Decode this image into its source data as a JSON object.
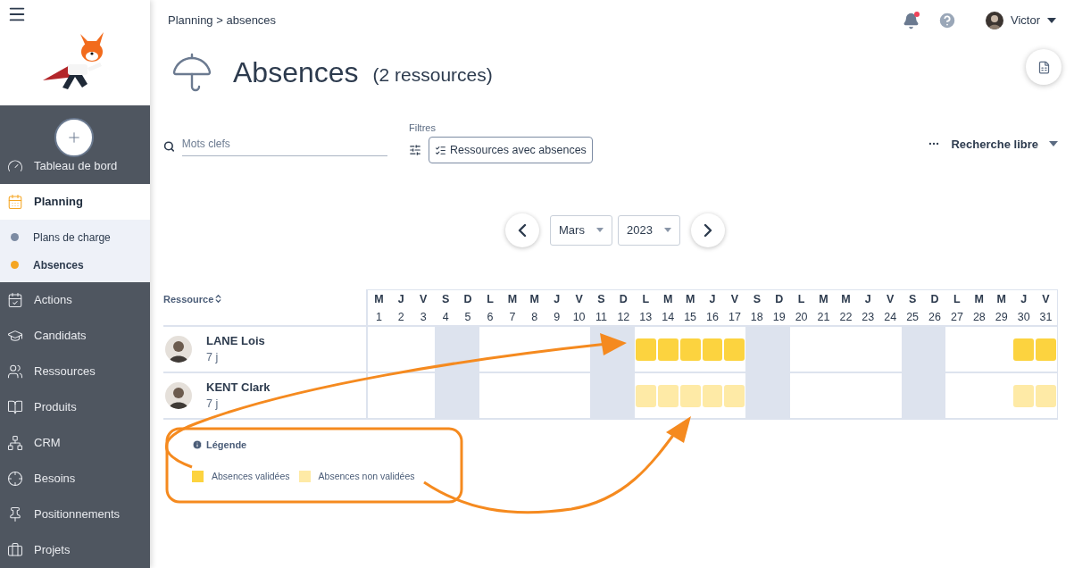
{
  "sidebar": {
    "items": [
      {
        "label": "Tableau de bord",
        "selected": false
      },
      {
        "label": "Planning",
        "selected": true,
        "children": [
          {
            "label": "Plans de charge",
            "selected": false
          },
          {
            "label": "Absences",
            "selected": true
          }
        ]
      },
      {
        "label": "Actions",
        "selected": false
      },
      {
        "label": "Candidats",
        "selected": false
      },
      {
        "label": "Ressources",
        "selected": false
      },
      {
        "label": "Produits",
        "selected": false
      },
      {
        "label": "CRM",
        "selected": false
      },
      {
        "label": "Besoins",
        "selected": false
      },
      {
        "label": "Positionnements",
        "selected": false
      },
      {
        "label": "Projets",
        "selected": false
      }
    ]
  },
  "breadcrumb": {
    "parent": "Planning",
    "separator": ">",
    "current": "absences"
  },
  "user": {
    "name": "Victor",
    "has_notification": true
  },
  "page": {
    "title": "Absences",
    "count": "(2 ressources)"
  },
  "search": {
    "placeholder": "Mots clefs"
  },
  "filters": {
    "label": "Filtres",
    "chip": "Ressources avec absences",
    "free_search": "Recherche libre"
  },
  "period": {
    "month": "Mars",
    "year": "2023"
  },
  "table": {
    "resource_header": "Ressource",
    "days": [
      {
        "letter": "M",
        "number": "1",
        "kind": "weekday"
      },
      {
        "letter": "J",
        "number": "2",
        "kind": "weekday"
      },
      {
        "letter": "V",
        "number": "3",
        "kind": "weekday"
      },
      {
        "letter": "S",
        "number": "4",
        "kind": "weekend"
      },
      {
        "letter": "D",
        "number": "5",
        "kind": "weekend"
      },
      {
        "letter": "L",
        "number": "6",
        "kind": "weekday"
      },
      {
        "letter": "M",
        "number": "7",
        "kind": "weekday"
      },
      {
        "letter": "M",
        "number": "8",
        "kind": "weekday"
      },
      {
        "letter": "J",
        "number": "9",
        "kind": "weekday"
      },
      {
        "letter": "V",
        "number": "10",
        "kind": "weekday"
      },
      {
        "letter": "S",
        "number": "11",
        "kind": "weekend"
      },
      {
        "letter": "D",
        "number": "12",
        "kind": "weekend"
      },
      {
        "letter": "L",
        "number": "13",
        "kind": "weekday"
      },
      {
        "letter": "M",
        "number": "14",
        "kind": "weekday"
      },
      {
        "letter": "M",
        "number": "15",
        "kind": "weekday"
      },
      {
        "letter": "J",
        "number": "16",
        "kind": "weekday"
      },
      {
        "letter": "V",
        "number": "17",
        "kind": "weekday"
      },
      {
        "letter": "S",
        "number": "18",
        "kind": "weekend"
      },
      {
        "letter": "D",
        "number": "19",
        "kind": "weekend"
      },
      {
        "letter": "L",
        "number": "20",
        "kind": "weekday"
      },
      {
        "letter": "M",
        "number": "21",
        "kind": "weekday"
      },
      {
        "letter": "M",
        "number": "22",
        "kind": "weekday"
      },
      {
        "letter": "J",
        "number": "23",
        "kind": "weekday"
      },
      {
        "letter": "V",
        "number": "24",
        "kind": "weekday"
      },
      {
        "letter": "S",
        "number": "25",
        "kind": "weekend"
      },
      {
        "letter": "D",
        "number": "26",
        "kind": "weekend"
      },
      {
        "letter": "L",
        "number": "27",
        "kind": "weekday"
      },
      {
        "letter": "M",
        "number": "28",
        "kind": "weekday"
      },
      {
        "letter": "M",
        "number": "29",
        "kind": "weekday"
      },
      {
        "letter": "J",
        "number": "30",
        "kind": "weekday"
      },
      {
        "letter": "V",
        "number": "31",
        "kind": "weekday"
      }
    ],
    "rows": [
      {
        "name": "LANE Lois",
        "total": "7 j",
        "cells": [
          null,
          null,
          null,
          null,
          null,
          null,
          null,
          null,
          null,
          null,
          null,
          null,
          {
            "validated": true
          },
          {
            "validated": true
          },
          {
            "validated": true
          },
          {
            "validated": true
          },
          {
            "validated": true
          },
          null,
          null,
          null,
          null,
          null,
          null,
          null,
          null,
          null,
          null,
          null,
          null,
          {
            "validated": true
          },
          {
            "validated": true
          }
        ]
      },
      {
        "name": "KENT Clark",
        "total": "7 j",
        "cells": [
          null,
          null,
          null,
          null,
          null,
          null,
          null,
          null,
          null,
          null,
          null,
          null,
          {
            "validated": false
          },
          {
            "validated": false
          },
          {
            "validated": false
          },
          {
            "validated": false
          },
          {
            "validated": false
          },
          null,
          null,
          null,
          null,
          null,
          null,
          null,
          null,
          null,
          null,
          null,
          null,
          {
            "validated": false
          },
          {
            "validated": false
          }
        ]
      }
    ]
  },
  "legend": {
    "title": "Légende",
    "items": [
      {
        "label": "Absences validées",
        "color": "#fcd33f"
      },
      {
        "label": "Absences non validées",
        "color": "#feeaa6"
      }
    ]
  }
}
